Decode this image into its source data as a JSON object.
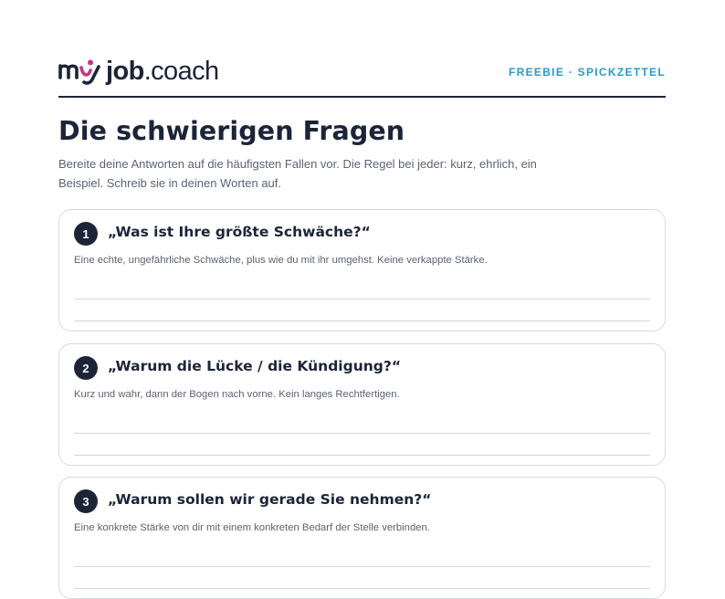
{
  "header": {
    "logo_part1": "my",
    "logo_part2": "job",
    "logo_part3": ".coach",
    "tag": "FREEBIE · SPICKZETTEL"
  },
  "page": {
    "title": "Die schwierigen Fragen",
    "intro": "Bereite deine Antworten auf die häufigsten Fallen vor. Die Regel bei jeder: kurz, ehrlich, ein Beispiel. Schreib sie in deinen Worten auf."
  },
  "questions": [
    {
      "number": "1",
      "question": "„Was ist Ihre größte Schwäche?“",
      "hint": "Eine echte, ungefährliche Schwäche, plus wie du mit ihr umgehst. Keine verkappte Stärke."
    },
    {
      "number": "2",
      "question": "„Warum die Lücke / die Kündigung?“",
      "hint": "Kurz und wahr, dann der Bogen nach vorne. Kein langes Rechtfertigen."
    },
    {
      "number": "3",
      "question": "„Warum sollen wir gerade Sie nehmen?“",
      "hint": "Eine konkrete Stärke von dir mit einem konkreten Bedarf der Stelle verbinden."
    }
  ],
  "colors": {
    "navy": "#1c2438",
    "accent": "#2a9bc6",
    "logo_magenta": "#c23a86"
  }
}
